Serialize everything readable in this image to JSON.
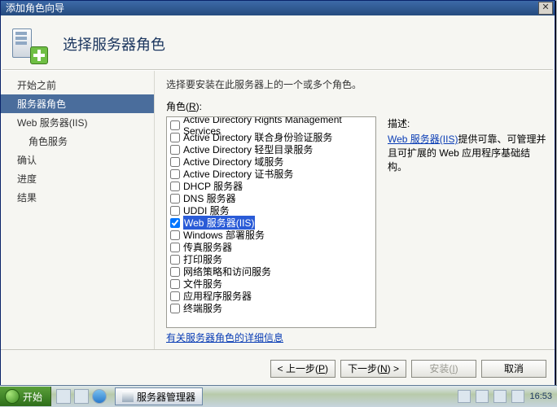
{
  "window": {
    "title": "添加角色向导",
    "heading": "选择服务器角色"
  },
  "nav": {
    "items": [
      {
        "label": "开始之前",
        "sub": false,
        "selected": false
      },
      {
        "label": "服务器角色",
        "sub": false,
        "selected": true
      },
      {
        "label": "Web 服务器(IIS)",
        "sub": false,
        "selected": false
      },
      {
        "label": "角色服务",
        "sub": true,
        "selected": false
      },
      {
        "label": "确认",
        "sub": false,
        "selected": false
      },
      {
        "label": "进度",
        "sub": false,
        "selected": false
      },
      {
        "label": "结果",
        "sub": false,
        "selected": false
      }
    ]
  },
  "main": {
    "instruction": "选择要安装在此服务器上的一个或多个角色。",
    "roles_label_prefix": "角色(",
    "roles_label_key": "R",
    "roles_label_suffix": "):",
    "desc_heading": "描述:",
    "desc_link": "Web 服务器(IIS)",
    "desc_text": "提供可靠、可管理并且可扩展的 Web 应用程序基础结构。",
    "more_link": "有关服务器角色的详细信息",
    "roles": [
      {
        "label": "Active Directory Rights Management Services",
        "checked": false,
        "selected": false
      },
      {
        "label": "Active Directory 联合身份验证服务",
        "checked": false,
        "selected": false
      },
      {
        "label": "Active Directory 轻型目录服务",
        "checked": false,
        "selected": false
      },
      {
        "label": "Active Directory 域服务",
        "checked": false,
        "selected": false
      },
      {
        "label": "Active Directory 证书服务",
        "checked": false,
        "selected": false
      },
      {
        "label": "DHCP 服务器",
        "checked": false,
        "selected": false
      },
      {
        "label": "DNS 服务器",
        "checked": false,
        "selected": false
      },
      {
        "label": "UDDI 服务",
        "checked": false,
        "selected": false
      },
      {
        "label": "Web 服务器(IIS)",
        "checked": true,
        "selected": true
      },
      {
        "label": "Windows 部署服务",
        "checked": false,
        "selected": false
      },
      {
        "label": "传真服务器",
        "checked": false,
        "selected": false
      },
      {
        "label": "打印服务",
        "checked": false,
        "selected": false
      },
      {
        "label": "网络策略和访问服务",
        "checked": false,
        "selected": false
      },
      {
        "label": "文件服务",
        "checked": false,
        "selected": false
      },
      {
        "label": "应用程序服务器",
        "checked": false,
        "selected": false
      },
      {
        "label": "终端服务",
        "checked": false,
        "selected": false
      }
    ]
  },
  "footer": {
    "prev_prefix": "< 上一步(",
    "prev_key": "P",
    "prev_suffix": ")",
    "next_prefix": "下一步(",
    "next_key": "N",
    "next_suffix": ") >",
    "install_prefix": "安装(",
    "install_key": "I",
    "install_suffix": ")",
    "cancel": "取消"
  },
  "taskbar": {
    "start": "开始",
    "task1": "服务器管理器",
    "clock": "16:53"
  }
}
